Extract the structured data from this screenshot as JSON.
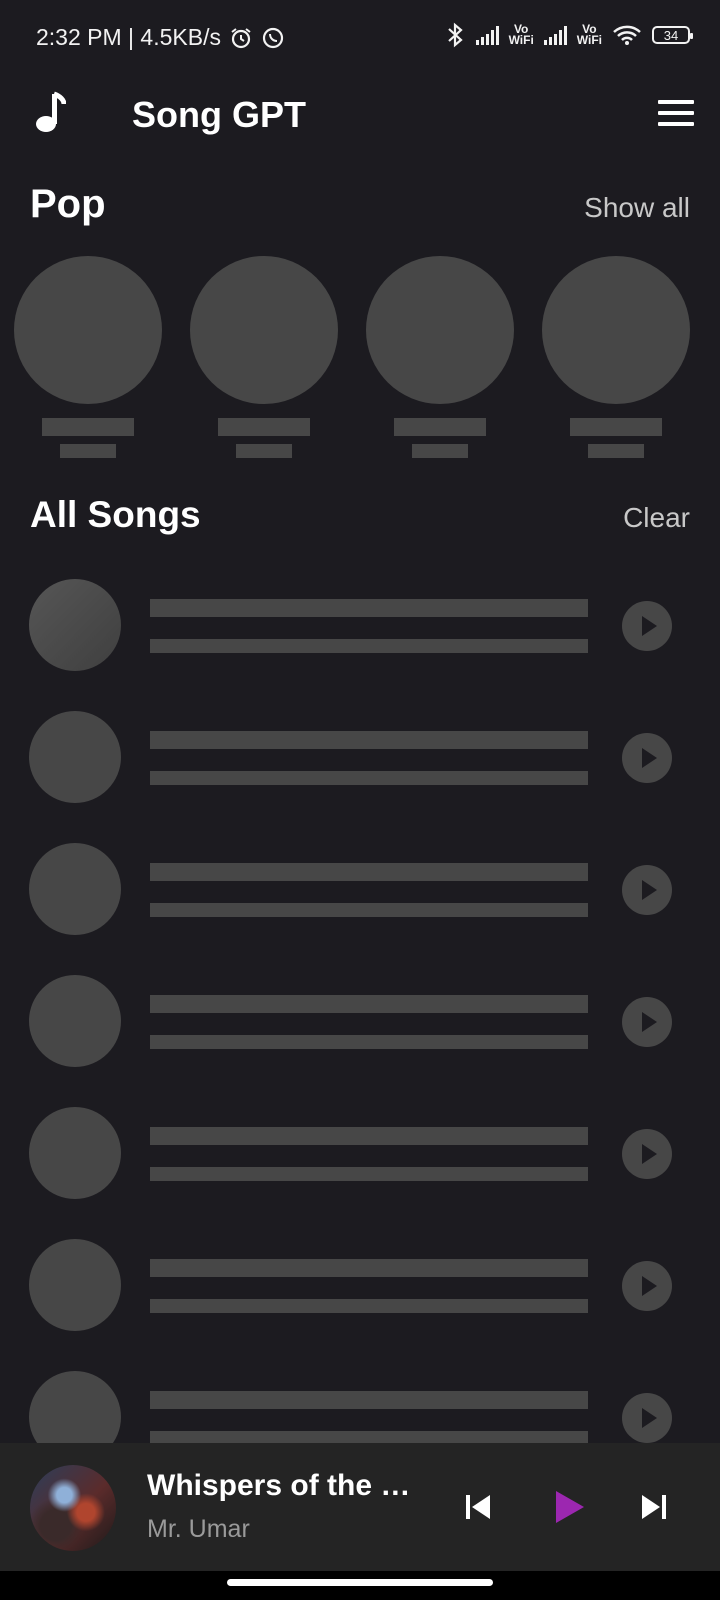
{
  "status_bar": {
    "time_speed": "2:32 PM | 4.5KB/s",
    "vowifi_label_1": "Vo\nWiFi",
    "vowifi_label_2": "Vo\nWiFi",
    "battery": "34",
    "icons": [
      "alarm-icon",
      "whatsapp-icon",
      "bluetooth-icon",
      "signal-icon",
      "wifi-icon",
      "battery-icon"
    ]
  },
  "app_bar": {
    "title": "Song GPT",
    "icons": [
      "music-note-icon",
      "hamburger-menu-icon"
    ]
  },
  "pop_section": {
    "title": "Pop",
    "action": "Show all",
    "placeholder_count": 4
  },
  "all_songs_section": {
    "title": "All Songs",
    "action": "Clear",
    "placeholder_count": 7
  },
  "now_playing": {
    "title": "Whispers of the Pe…",
    "artist": "Mr. Umar",
    "accent_color": "#9c27b0",
    "icons": [
      "previous-icon",
      "play-icon",
      "next-icon"
    ]
  },
  "colors": {
    "background": "#1c1b20",
    "skeleton": "#474747",
    "player_background": "#242424"
  }
}
